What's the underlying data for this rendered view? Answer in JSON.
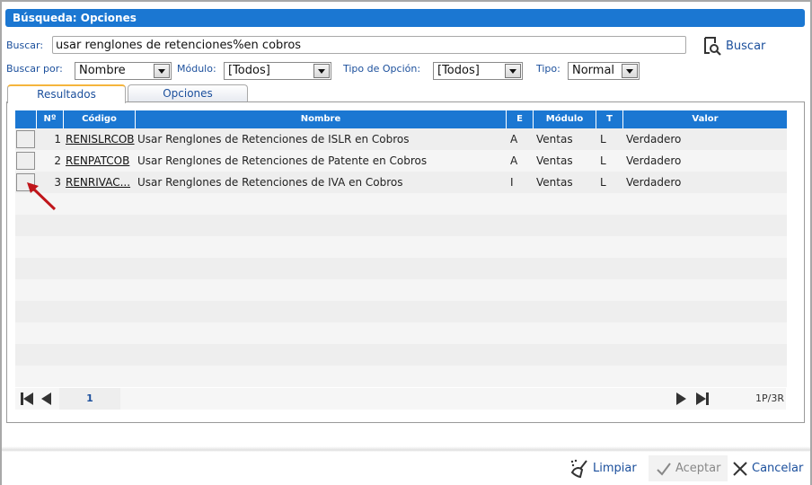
{
  "dialog": {
    "title": "Búsqueda: Opciones"
  },
  "search": {
    "label": "Buscar:",
    "value": "usar renglones de retenciones%en cobros",
    "button_label": "Buscar"
  },
  "filters": {
    "buscar_por": {
      "label": "Buscar por:",
      "value": "Nombre"
    },
    "modulo": {
      "label": "Módulo:",
      "value": "[Todos]"
    },
    "tipo_opcion": {
      "label": "Tipo de Opción:",
      "value": "[Todos]"
    },
    "tipo": {
      "label": "Tipo:",
      "value": "Normal"
    }
  },
  "tabs": [
    {
      "label": "Resultados",
      "active": true
    },
    {
      "label": "Opciones",
      "active": false
    }
  ],
  "grid": {
    "columns": [
      "",
      "Nº",
      "Código",
      "Nombre",
      "E",
      "Módulo",
      "T",
      "Valor"
    ],
    "rows": [
      {
        "no": "1",
        "codigo": "RENISLRCOB",
        "nombre": "Usar Renglones de Retenciones de ISLR en Cobros",
        "e": "A",
        "modulo": "Ventas",
        "t": "L",
        "valor": "Verdadero"
      },
      {
        "no": "2",
        "codigo": "RENPATCOB",
        "nombre": "Usar Renglones de Retenciones de Patente en Cobros",
        "e": "A",
        "modulo": "Ventas",
        "t": "L",
        "valor": "Verdadero"
      },
      {
        "no": "3",
        "codigo": "RENRIVAC...",
        "nombre": "Usar Renglones de Retenciones de IVA en Cobros",
        "e": "I",
        "modulo": "Ventas",
        "t": "L",
        "valor": "Verdadero"
      }
    ],
    "empty_rows": 9
  },
  "pager": {
    "current_page": "1",
    "count": "1P/3R"
  },
  "footer": {
    "limpiar": "Limpiar",
    "aceptar": "Aceptar",
    "cancelar": "Cancelar"
  },
  "colors": {
    "accent": "#1b77d2",
    "link_text": "#1b4f9c",
    "tab_highlight": "#f5b53d",
    "annotation_arrow": "#c0161b"
  }
}
